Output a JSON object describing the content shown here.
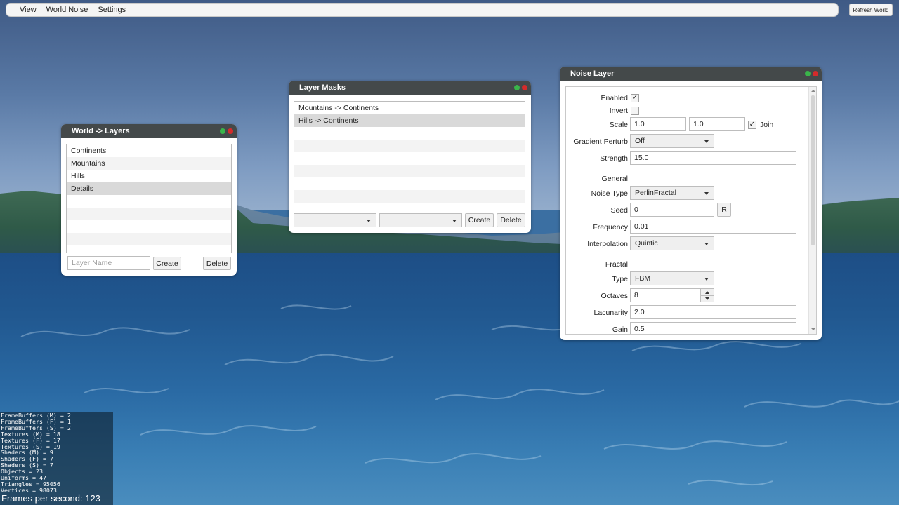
{
  "menubar": {
    "items": [
      "View",
      "World Noise",
      "Settings"
    ],
    "refresh_label": "Refresh World"
  },
  "world_layers": {
    "title": "World -> Layers",
    "items": [
      "Continents",
      "Mountains",
      "Hills",
      "Details"
    ],
    "selected_index": 3,
    "name_placeholder": "Layer Name",
    "create_label": "Create",
    "delete_label": "Delete"
  },
  "layer_masks": {
    "title": "Layer Masks",
    "items": [
      "Mountains -> Continents",
      "Hills -> Continents"
    ],
    "selected_index": 1,
    "combo1_value": "",
    "combo2_value": "",
    "create_label": "Create",
    "delete_label": "Delete"
  },
  "noise_layer": {
    "title": "Noise Layer",
    "enabled_label": "Enabled",
    "enabled": true,
    "invert_label": "Invert",
    "invert": false,
    "scale_label": "Scale",
    "scale_x": "1.0",
    "scale_y": "1.0",
    "join_label": "Join",
    "join": true,
    "gradient_perturb_label": "Gradient Perturb",
    "gradient_perturb_value": "Off",
    "strength_label": "Strength",
    "strength_value": "15.0",
    "general_label": "General",
    "noise_type_label": "Noise Type",
    "noise_type_value": "PerlinFractal",
    "seed_label": "Seed",
    "seed_value": "0",
    "seed_button": "R",
    "frequency_label": "Frequency",
    "frequency_value": "0.01",
    "interpolation_label": "Interpolation",
    "interpolation_value": "Quintic",
    "fractal_label": "Fractal",
    "type_label": "Type",
    "type_value": "FBM",
    "octaves_label": "Octaves",
    "octaves_value": "8",
    "lacunarity_label": "Lacunarity",
    "lacunarity_value": "2.0",
    "gain_label": "Gain",
    "gain_value": "0.5"
  },
  "stats": {
    "lines": [
      "FrameBuffers (M) = 2",
      "FrameBuffers (F) = 1",
      "FrameBuffers (S) = 2",
      "Textures (M) = 18",
      "Textures (F) = 17",
      "Textures (S) = 19",
      "Shaders (M) = 9",
      "Shaders (F) = 7",
      "Shaders (S) = 7",
      "Objects = 23",
      "Uniforms = 47",
      "Triangles = 95056",
      "Vertices = 98073"
    ],
    "fps_text": "Frames per second: 123"
  },
  "colors": {
    "title_bar": "#44494a",
    "dot_green": "#3ab54a",
    "dot_red": "#d42b2b",
    "water": "#215890"
  }
}
